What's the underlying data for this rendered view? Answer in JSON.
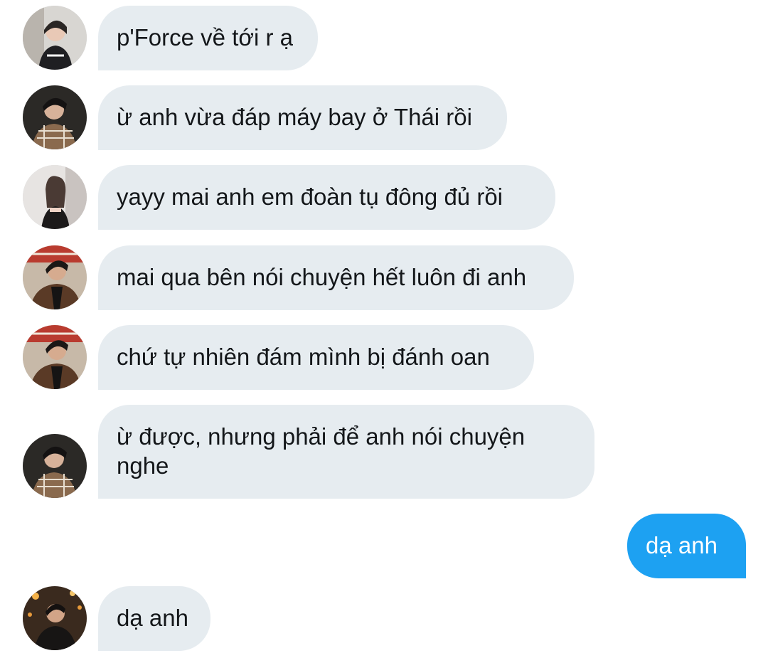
{
  "conversation": {
    "messages": [
      {
        "sender": "avatar-1",
        "direction": "incoming",
        "text": "p'Force về tới r ạ"
      },
      {
        "sender": "avatar-2",
        "direction": "incoming",
        "text": "ừ anh vừa đáp máy bay ở Thái rồi"
      },
      {
        "sender": "avatar-3",
        "direction": "incoming",
        "text": "yayy mai anh em đoàn tụ đông đủ rồi"
      },
      {
        "sender": "avatar-4",
        "direction": "incoming",
        "text": "mai qua bên nói chuyện hết luôn đi anh"
      },
      {
        "sender": "avatar-4",
        "direction": "incoming",
        "text": "chứ tự nhiên đám mình bị đánh oan"
      },
      {
        "sender": "avatar-2",
        "direction": "incoming",
        "text": "ừ được, nhưng phải để anh nói chuyện nghe"
      },
      {
        "sender": "me",
        "direction": "outgoing",
        "text": "dạ anh"
      },
      {
        "sender": "avatar-5",
        "direction": "incoming",
        "text": "dạ anh"
      }
    ]
  },
  "colors": {
    "incoming_bubble": "#e6ecf0",
    "outgoing_bubble": "#1da1f2",
    "incoming_text": "#14171a",
    "outgoing_text": "#ffffff"
  }
}
